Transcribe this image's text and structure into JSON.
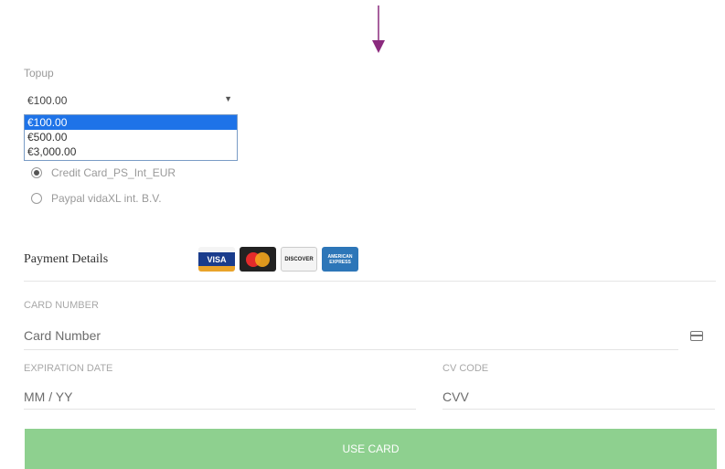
{
  "topup": {
    "label": "Topup",
    "selected": "€100.00",
    "options": [
      "€100.00",
      "€500.00",
      "€3,000.00"
    ]
  },
  "payment_methods": [
    {
      "label": "Credit Card_PS_Int_EUR",
      "checked": true
    },
    {
      "label": "Paypal vidaXL int. B.V.",
      "checked": false
    }
  ],
  "payment_details": {
    "title": "Payment Details",
    "card_logos": [
      "VISA",
      "MasterCard",
      "DISCOVER",
      "AMERICAN EXPRESS"
    ]
  },
  "card_number": {
    "label": "CARD NUMBER",
    "placeholder": "Card Number"
  },
  "expiration": {
    "label": "EXPIRATION DATE",
    "placeholder": "MM / YY"
  },
  "cvv": {
    "label": "CV CODE",
    "placeholder": "CVV"
  },
  "button": {
    "label": "USE CARD"
  },
  "colors": {
    "accent_arrow": "#8b2a7e",
    "button_bg": "#8ed08f",
    "selected_option": "#1e73e8"
  }
}
